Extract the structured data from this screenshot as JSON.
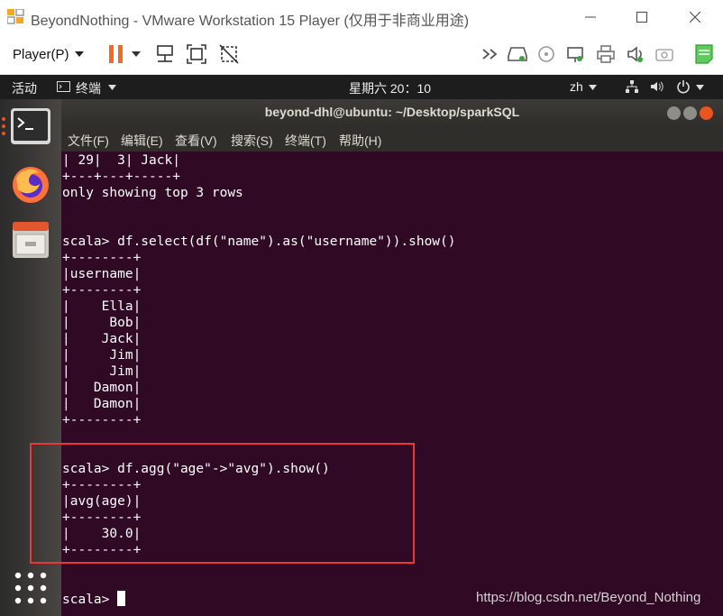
{
  "vmware": {
    "title": "BeyondNothing - VMware Workstation 15 Player (仅用于非商业用途)",
    "player_menu_label": "Player(P)",
    "toolbar_icons": [
      "pause-icon",
      "send-ctrl-alt-del-icon",
      "fit-guest-icon",
      "unity-icon",
      "forward-icon",
      "hard-disk-icon",
      "cd-icon",
      "network-icon",
      "printer-icon",
      "sound-icon",
      "camera-icon",
      "message-icon"
    ]
  },
  "ubuntu_panel": {
    "activities": "活动",
    "app_name": "终端",
    "clock": "星期六 20：10",
    "lang": "zh"
  },
  "terminal": {
    "title": "beyond-dhl@ubuntu: ~/Desktop/sparkSQL",
    "menu": [
      "文件(F)",
      "编辑(E)",
      "查看(V)",
      "搜索(S)",
      "终端(T)",
      "帮助(H)"
    ],
    "lines": [
      "| 29|  3| Jack|",
      "+---+---+-----+",
      "only showing top 3 rows",
      "",
      "",
      "scala> df.select(df(\"name\").as(\"username\")).show()",
      "+--------+",
      "|username|",
      "+--------+",
      "|    Ella|",
      "|     Bob|",
      "|    Jack|",
      "|     Jim|",
      "|     Jim|",
      "|   Damon|",
      "|   Damon|",
      "+--------+",
      "",
      "",
      "scala> df.agg(\"age\"->\"avg\").show()",
      "+--------+",
      "|avg(age)|",
      "+--------+",
      "|    30.0|",
      "+--------+",
      "",
      "",
      "scala> "
    ]
  },
  "watermark": "https://blog.csdn.net/Beyond_Nothing"
}
